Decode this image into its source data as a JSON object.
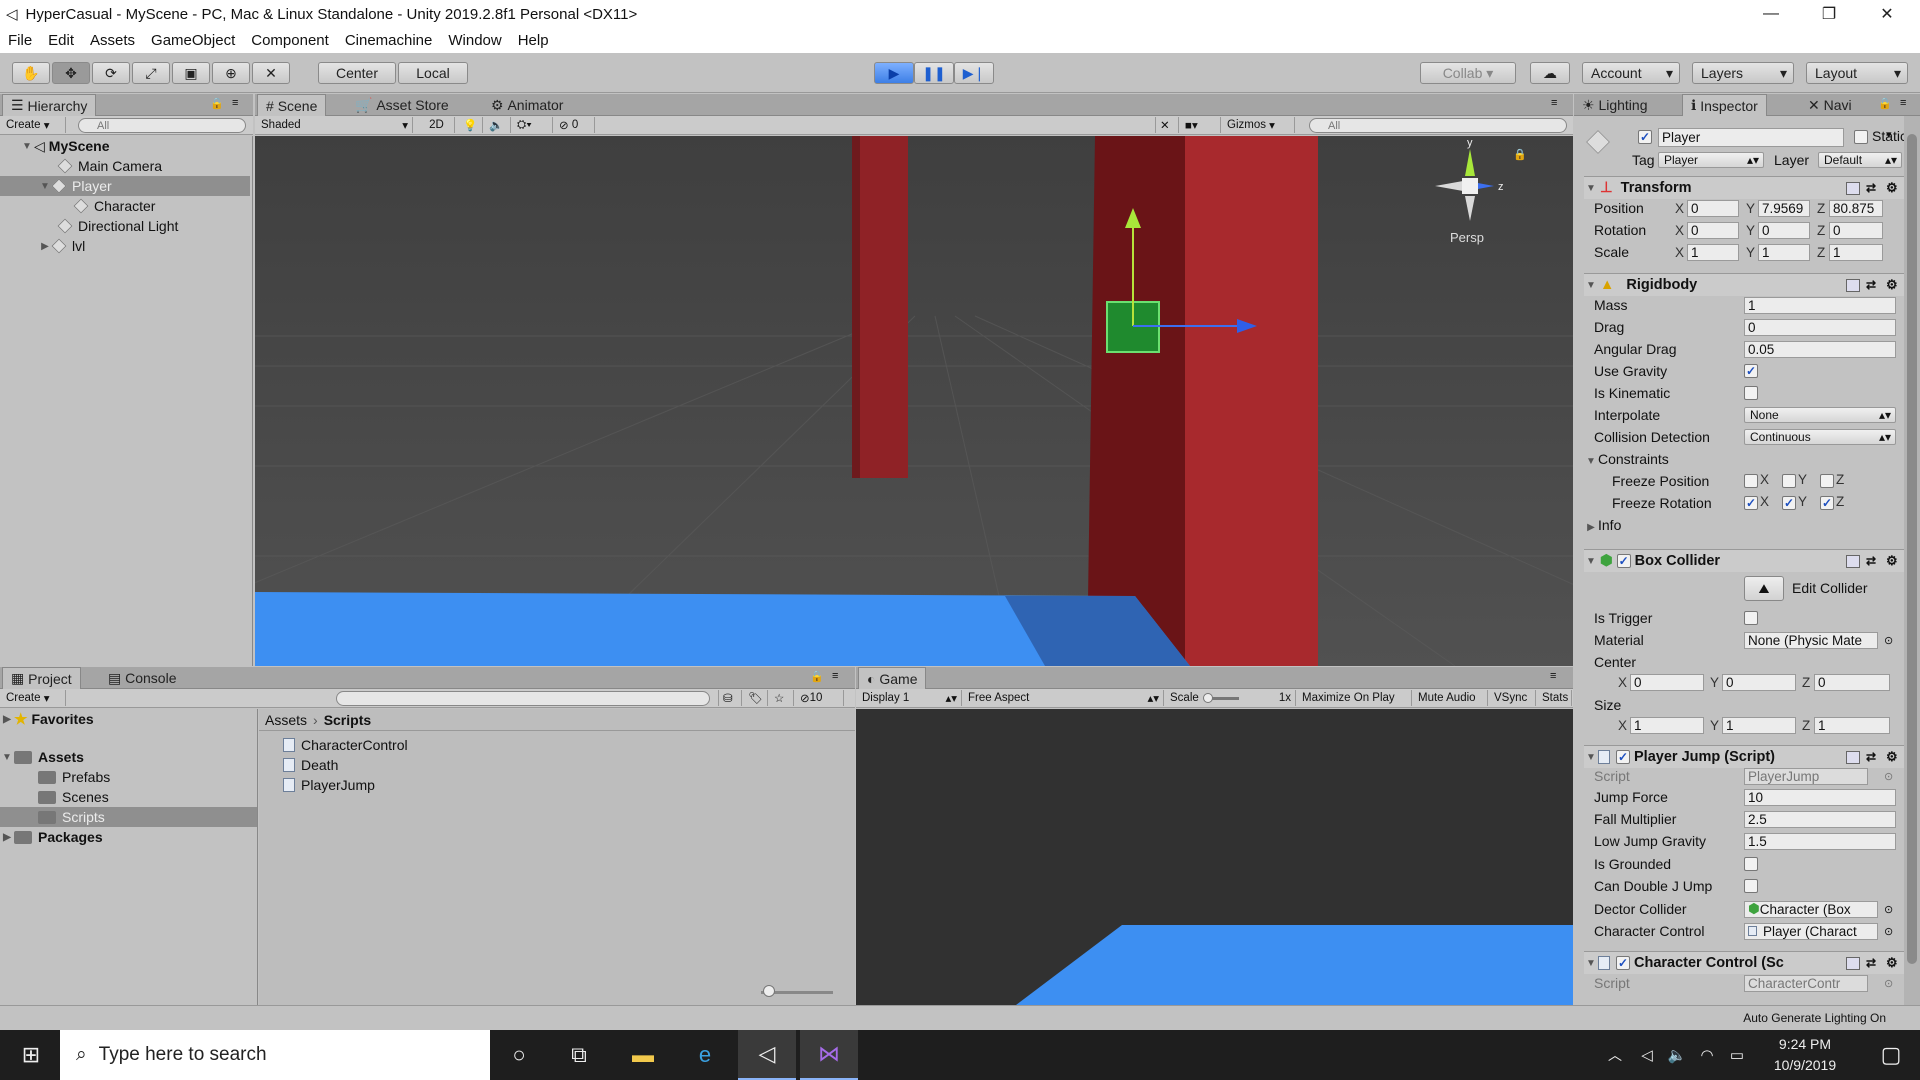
{
  "window": {
    "title": "HyperCasual - MyScene - PC, Mac & Linux Standalone - Unity 2019.2.8f1 Personal <DX11>",
    "minimize": "—",
    "restore": "❐",
    "close": "✕"
  },
  "menu": [
    "File",
    "Edit",
    "Assets",
    "GameObject",
    "Component",
    "Cinemachine",
    "Window",
    "Help"
  ],
  "toolbar": {
    "center": "Center",
    "local": "Local",
    "collab": "Collab",
    "account": "Account",
    "layers": "Layers",
    "layout": "Layout"
  },
  "hierarchy": {
    "tab": "Hierarchy",
    "create": "Create",
    "search": "All",
    "scene": "MyScene",
    "items": [
      "Main Camera",
      "Player",
      "Character",
      "Directional Light",
      "lvl"
    ]
  },
  "scene": {
    "tabs": [
      "Scene",
      "Asset Store",
      "Animator"
    ],
    "shading": "Shaded",
    "mode2d": "2D",
    "hidden_count": "0",
    "gizmos": "Gizmos",
    "search": "All",
    "persp": "Persp",
    "axis_y": "y",
    "axis_z": "z"
  },
  "project": {
    "tabs": [
      "Project",
      "Console"
    ],
    "create": "Create",
    "hidden_count": "10",
    "tree": {
      "favorites": "Favorites",
      "assets": "Assets",
      "children": [
        "Prefabs",
        "Scenes",
        "Scripts"
      ],
      "packages": "Packages"
    },
    "breadcrumb": [
      "Assets",
      "Scripts"
    ],
    "files": [
      "CharacterControl",
      "Death",
      "PlayerJump"
    ]
  },
  "game": {
    "tab": "Game",
    "display": "Display 1",
    "aspect": "Free Aspect",
    "scale_label": "Scale",
    "scale_value": "1x",
    "maximize": "Maximize On Play",
    "mute": "Mute Audio",
    "vsync": "VSync",
    "stats": "Stats"
  },
  "inspector": {
    "tabs": [
      "Lighting",
      "Inspector",
      "Navi"
    ],
    "object": {
      "name": "Player",
      "static_label": "Static",
      "tag_label": "Tag",
      "tag": "Player",
      "layer_label": "Layer",
      "layer": "Default"
    },
    "transform": {
      "title": "Transform",
      "position": {
        "label": "Position",
        "x": "0",
        "y": "7.9569",
        "z": "80.875"
      },
      "rotation": {
        "label": "Rotation",
        "x": "0",
        "y": "0",
        "z": "0"
      },
      "scale": {
        "label": "Scale",
        "x": "1",
        "y": "1",
        "z": "1"
      }
    },
    "rigidbody": {
      "title": "Rigidbody",
      "mass": {
        "label": "Mass",
        "value": "1"
      },
      "drag": {
        "label": "Drag",
        "value": "0"
      },
      "angular_drag": {
        "label": "Angular Drag",
        "value": "0.05"
      },
      "use_gravity": "Use Gravity",
      "is_kinematic": "Is Kinematic",
      "interpolate": {
        "label": "Interpolate",
        "value": "None"
      },
      "collision": {
        "label": "Collision Detection",
        "value": "Continuous"
      },
      "constraints": "Constraints",
      "freeze_pos": "Freeze Position",
      "freeze_rot": "Freeze Rotation",
      "info": "Info"
    },
    "box_collider": {
      "title": "Box Collider",
      "edit": "Edit Collider",
      "is_trigger": "Is Trigger",
      "material": {
        "label": "Material",
        "value": "None (Physic Mate"
      },
      "center": {
        "label": "Center",
        "x": "0",
        "y": "0",
        "z": "0"
      },
      "size": {
        "label": "Size",
        "x": "1",
        "y": "1",
        "z": "1"
      }
    },
    "player_jump": {
      "title": "Player Jump (Script)",
      "script": {
        "label": "Script",
        "value": "PlayerJump"
      },
      "jump_force": {
        "label": "Jump Force",
        "value": "10"
      },
      "fall_mult": {
        "label": "Fall Multiplier",
        "value": "2.5"
      },
      "low_jump": {
        "label": "Low Jump Gravity",
        "value": "1.5"
      },
      "is_grounded": "Is Grounded",
      "double_jump": "Can Double J Ump",
      "dector": {
        "label": "Dector Collider",
        "value": "Character (Box"
      },
      "char_ctrl": {
        "label": "Character Control",
        "value": "Player (Charact"
      }
    },
    "character_control": {
      "title": "Character Control (Sc",
      "script": {
        "label": "Script",
        "value": "CharacterContr"
      }
    }
  },
  "status": {
    "lighting": "Auto Generate Lighting On"
  },
  "taskbar": {
    "search_placeholder": "Type here to search",
    "time": "9:24 PM",
    "date": "10/9/2019"
  },
  "colors": {
    "red_pillar": "#a42a2e",
    "blue_floor": "#3f8ef0",
    "scene_bg": "#474747",
    "game_bg": "#313131"
  }
}
